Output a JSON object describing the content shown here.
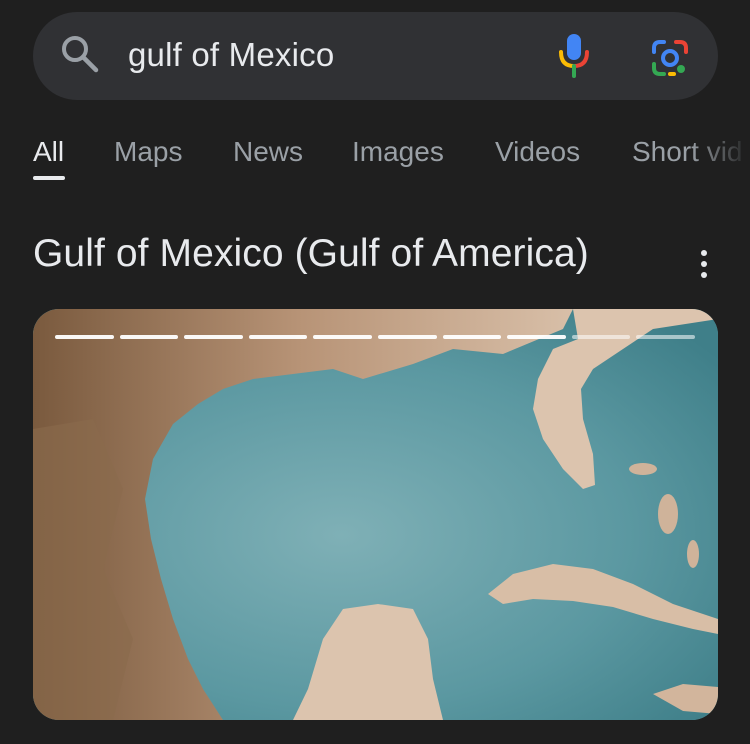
{
  "search": {
    "query": "gulf of Mexico"
  },
  "tabs": [
    {
      "label": "All",
      "active": true
    },
    {
      "label": "Maps",
      "active": false
    },
    {
      "label": "News",
      "active": false
    },
    {
      "label": "Images",
      "active": false
    },
    {
      "label": "Videos",
      "active": false
    },
    {
      "label": "Short vid",
      "active": false
    }
  ],
  "result": {
    "title": "Gulf of Mexico (Gulf of America)"
  },
  "slideshow": {
    "segments_total": 10,
    "segments_viewed": 8
  },
  "colors": {
    "background": "#1f1f1f",
    "searchbar": "#303134",
    "text_primary": "#e8eaed",
    "text_secondary": "#9aa0a6",
    "water": "#5f9aa3",
    "land": "#d9bfa8"
  },
  "icons": {
    "search": "search-icon",
    "mic": "mic-icon",
    "lens": "google-lens-icon",
    "more": "more-vert-icon"
  }
}
